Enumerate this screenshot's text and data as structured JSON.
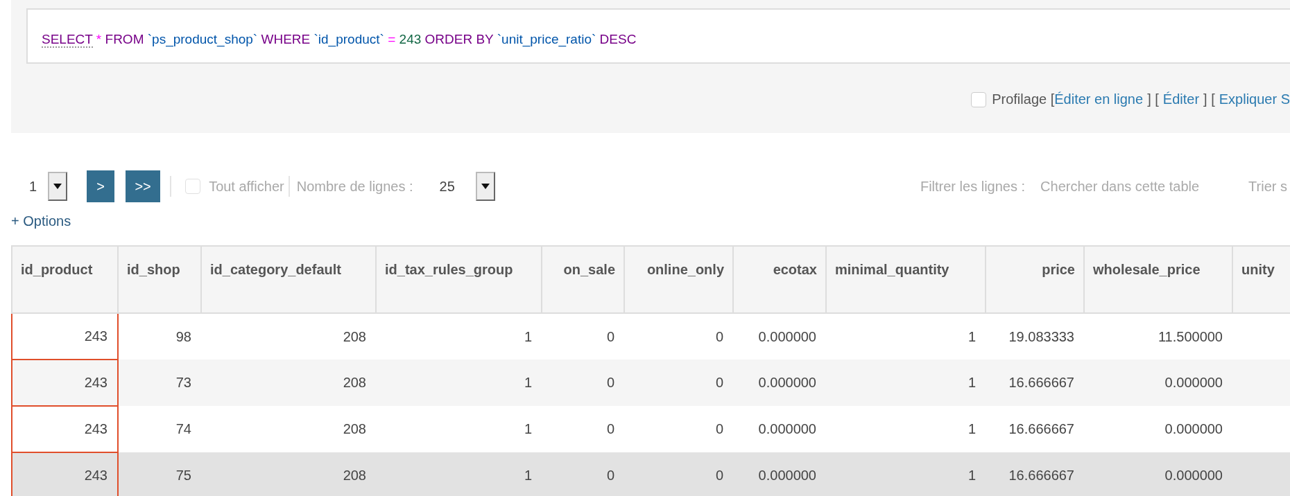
{
  "query": {
    "tokens": [
      {
        "text": "SELECT",
        "kind": "keyword",
        "link": true
      },
      {
        "text": "*",
        "kind": "operator"
      },
      {
        "text": "FROM",
        "kind": "keyword"
      },
      {
        "text": "`ps_product_shop`",
        "kind": "identifier"
      },
      {
        "text": "WHERE",
        "kind": "keyword"
      },
      {
        "text": "`id_product`",
        "kind": "identifier"
      },
      {
        "text": "=",
        "kind": "operator"
      },
      {
        "text": "243",
        "kind": "number"
      },
      {
        "text": "ORDER BY",
        "kind": "keyword"
      },
      {
        "text": "`unit_price_ratio`",
        "kind": "identifier"
      },
      {
        "text": "DESC",
        "kind": "keyword"
      }
    ]
  },
  "query_options": {
    "profiling": {
      "label": "Profilage",
      "checked": false
    },
    "items": [
      {
        "kind": "text",
        "text": "["
      },
      {
        "kind": "link",
        "text": "Éditer en ligne"
      },
      {
        "kind": "text",
        "text": "] ["
      },
      {
        "kind": "link",
        "text": "Éditer"
      },
      {
        "kind": "text",
        "text": "] ["
      },
      {
        "kind": "link",
        "text": "Expliquer S"
      }
    ]
  },
  "pager": {
    "page_select": {
      "value": "1"
    },
    "next_button": ">",
    "last_button": ">>",
    "show_all": {
      "label": "Tout afficher",
      "checked": false,
      "disabled": true
    },
    "rows_label": "Nombre de lignes :",
    "rows_select": {
      "value": "25"
    },
    "filter_label": "Filtrer les lignes :",
    "filter_field": {
      "placeholder": "Chercher dans cette table"
    },
    "sort_label": "Trier s"
  },
  "options_link": "+ Options",
  "table": {
    "columns": [
      "id_product",
      "id_shop",
      "id_category_default",
      "id_tax_rules_group",
      "on_sale",
      "online_only",
      "ecotax",
      "minimal_quantity",
      "price",
      "wholesale_price",
      "unity"
    ],
    "rows": [
      {
        "hovered": false,
        "cells": [
          "243",
          "98",
          "208",
          "1",
          "0",
          "0",
          "0.000000",
          "1",
          "19.083333",
          "11.500000"
        ]
      },
      {
        "hovered": false,
        "cells": [
          "243",
          "73",
          "208",
          "1",
          "0",
          "0",
          "0.000000",
          "1",
          "16.666667",
          "0.000000"
        ]
      },
      {
        "hovered": false,
        "cells": [
          "243",
          "74",
          "208",
          "1",
          "0",
          "0",
          "0.000000",
          "1",
          "16.666667",
          "0.000000"
        ]
      },
      {
        "hovered": true,
        "cells": [
          "243",
          "75",
          "208",
          "1",
          "0",
          "0",
          "0.000000",
          "1",
          "16.666667",
          "0.000000"
        ]
      }
    ]
  }
}
